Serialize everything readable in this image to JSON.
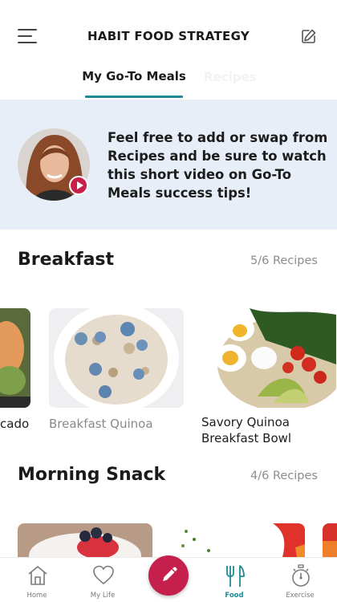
{
  "header": {
    "title": "HABIT FOOD STRATEGY",
    "tabs": [
      {
        "label": "My Go-To Meals",
        "active": true
      },
      {
        "label": "Recipes",
        "active": false
      }
    ],
    "accent_color": "#1f8a96"
  },
  "banner": {
    "text": "Feel free to add or swap from Recipes and be sure to watch this short video on Go-To Meals success tips!"
  },
  "sections": [
    {
      "title": "Breakfast",
      "count": "5/6 Recipes",
      "cards": [
        {
          "caption": "cado"
        },
        {
          "caption": "Breakfast Quinoa"
        },
        {
          "caption": "Savory Quinoa Breakfast Bowl"
        }
      ]
    },
    {
      "title": "Morning Snack",
      "count": "4/6 Recipes"
    }
  ],
  "tabbar": {
    "items": [
      {
        "label": "Home",
        "icon": "home-icon"
      },
      {
        "label": "My Life",
        "icon": "heart-icon"
      },
      {
        "label": "",
        "icon": "pencil-icon"
      },
      {
        "label": "Food",
        "icon": "fork-knife-icon",
        "active": true
      },
      {
        "label": "Exercise",
        "icon": "stopwatch-icon"
      }
    ],
    "active_color": "#1f8a96",
    "fab_color": "#c51f4d"
  }
}
